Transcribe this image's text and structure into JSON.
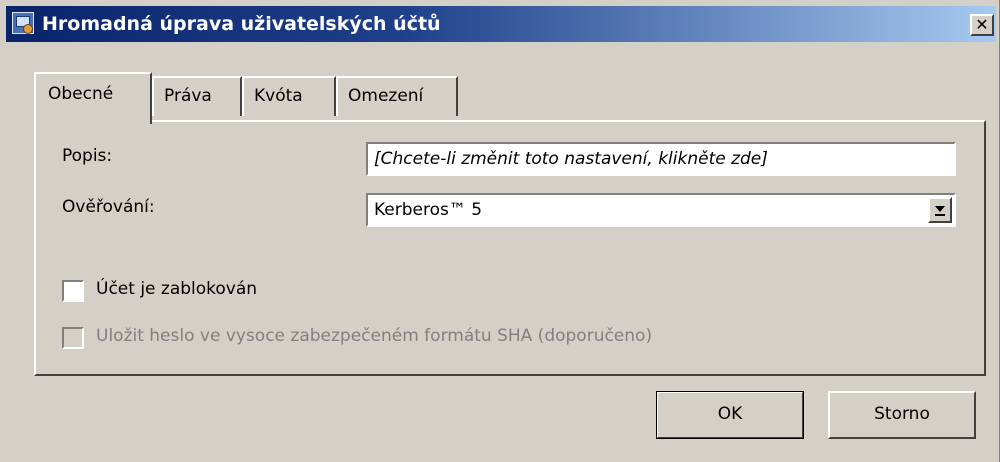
{
  "window": {
    "title": "Hromadná úprava uživatelských účtů",
    "close_glyph": "✕",
    "icon": "users-config-icon"
  },
  "tabs": [
    {
      "label": "Obecné",
      "active": true
    },
    {
      "label": "Práva",
      "active": false
    },
    {
      "label": "Kvóta",
      "active": false
    },
    {
      "label": "Omezení",
      "active": false
    }
  ],
  "form": {
    "description_label": "Popis:",
    "description_value": "[Chcete-li změnit toto nastavení, klikněte zde]",
    "auth_label": "Ověřování:",
    "auth_value": "Kerberos™ 5",
    "locked_label": "Účet je zablokován",
    "locked_checked": false,
    "sha_label": "Uložit heslo ve vysoce zabezpečeném formátu SHA (doporučeno)",
    "sha_checked": false,
    "sha_enabled": false
  },
  "buttons": {
    "ok": "OK",
    "cancel": "Storno"
  }
}
